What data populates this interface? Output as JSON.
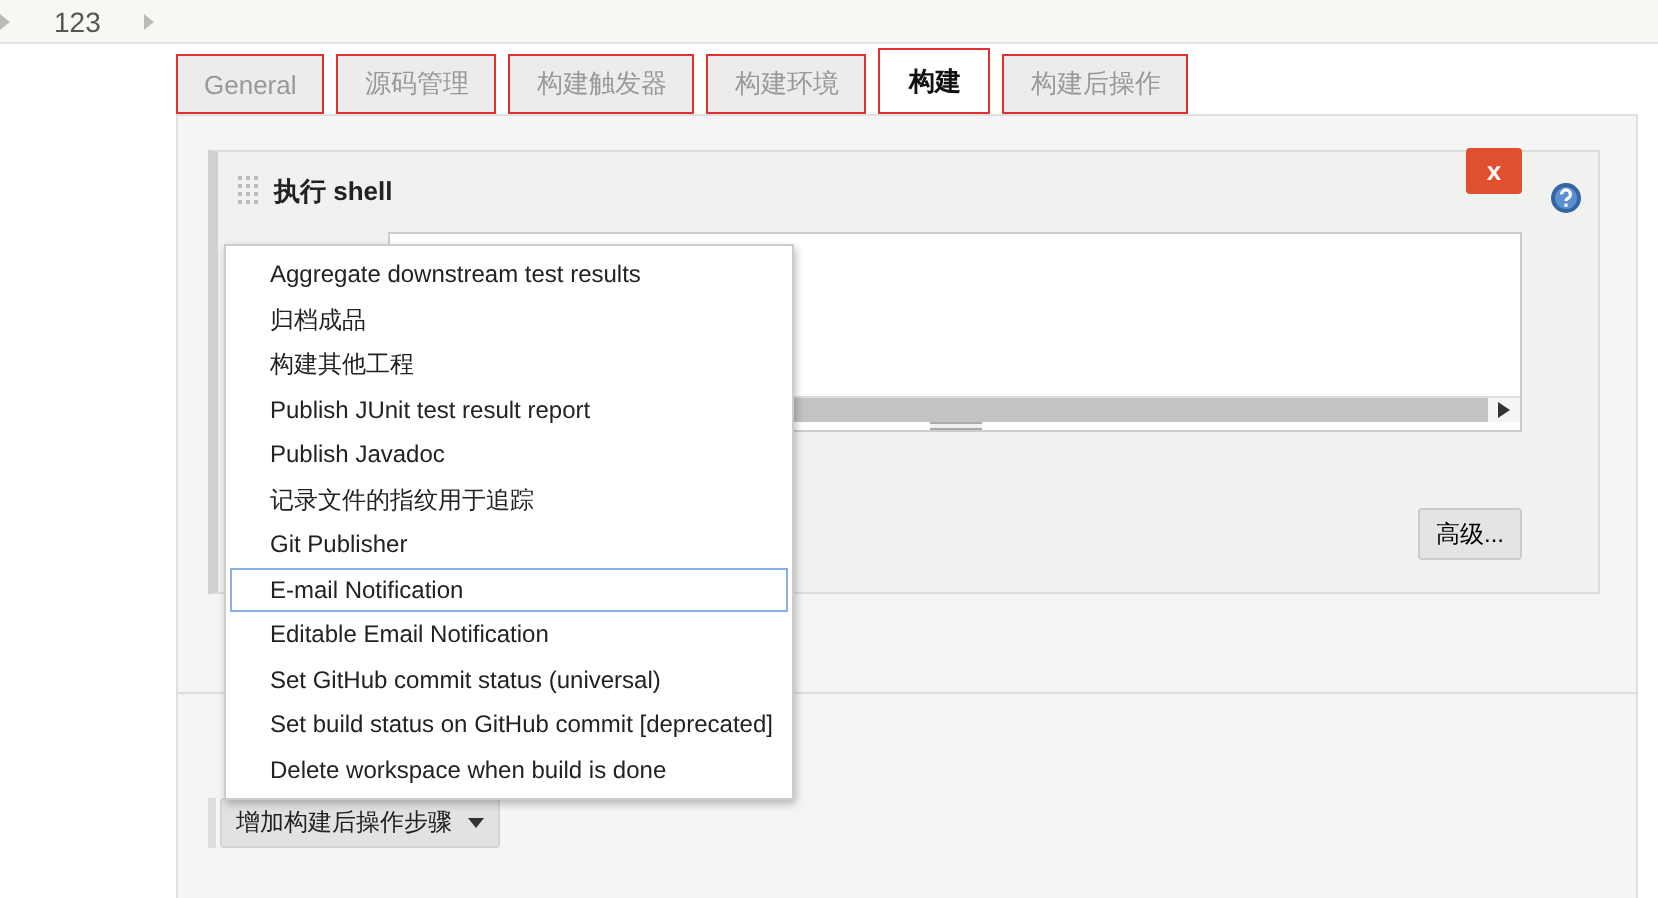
{
  "breadcrumb": {
    "items": [
      "123"
    ]
  },
  "tabs": [
    {
      "label": "General",
      "selected": false,
      "annotated": true
    },
    {
      "label": "源码管理",
      "selected": false,
      "annotated": true
    },
    {
      "label": "构建触发器",
      "selected": false,
      "annotated": true
    },
    {
      "label": "构建环境",
      "selected": false,
      "annotated": true
    },
    {
      "label": "构建",
      "selected": true,
      "annotated": true
    },
    {
      "label": "构建后操作",
      "selected": false,
      "annotated": true
    }
  ],
  "build_step": {
    "title": "执行 shell",
    "close_button": "x",
    "advanced_button": "高级..."
  },
  "add_post_build_button": "增加构建后操作步骤",
  "menu": {
    "items": [
      {
        "label": "Aggregate downstream test results",
        "selected": false
      },
      {
        "label": "归档成品",
        "selected": false
      },
      {
        "label": "构建其他工程",
        "selected": false
      },
      {
        "label": "Publish JUnit test result report",
        "selected": false
      },
      {
        "label": "Publish Javadoc",
        "selected": false
      },
      {
        "label": "记录文件的指纹用于追踪",
        "selected": false
      },
      {
        "label": "Git Publisher",
        "selected": false
      },
      {
        "label": "E-mail Notification",
        "selected": true
      },
      {
        "label": "Editable Email Notification",
        "selected": false
      },
      {
        "label": "Set GitHub commit status (universal)",
        "selected": false
      },
      {
        "label": "Set build status on GitHub commit [deprecated]",
        "selected": false
      },
      {
        "label": "Delete workspace when build is done",
        "selected": false
      }
    ]
  }
}
